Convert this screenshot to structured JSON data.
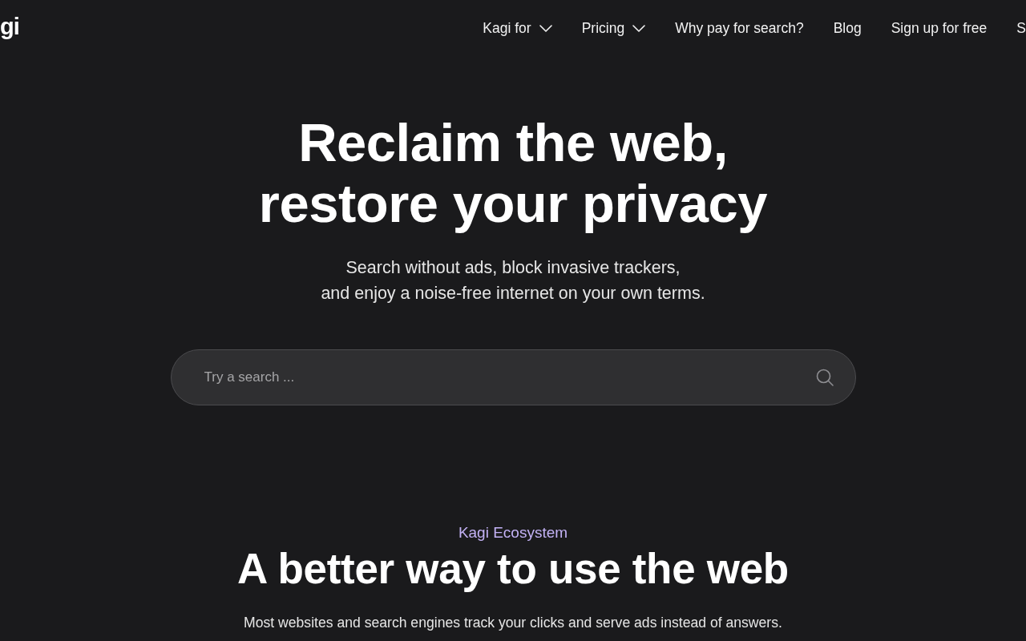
{
  "header": {
    "logo": "gi",
    "nav": [
      {
        "label": "Kagi for",
        "kind": "dropdown"
      },
      {
        "label": "Pricing",
        "kind": "dropdown"
      },
      {
        "label": "Why pay for search?",
        "kind": "link"
      },
      {
        "label": "Blog",
        "kind": "link"
      },
      {
        "label": "Sign up for free",
        "kind": "link"
      },
      {
        "label": "S",
        "kind": "link"
      }
    ]
  },
  "hero": {
    "title_lines": [
      "Reclaim the web,",
      "restore your privacy"
    ],
    "subtitle_lines": [
      "Search without ads, block invasive trackers,",
      "and enjoy a noise-free internet on your own terms."
    ],
    "search": {
      "placeholder": "Try a search ..."
    }
  },
  "ecosystem": {
    "eyebrow": "Kagi Ecosystem",
    "heading": "A better way to use the web",
    "intro": "Most websites and search engines track your clicks and serve ads instead of answers."
  }
}
